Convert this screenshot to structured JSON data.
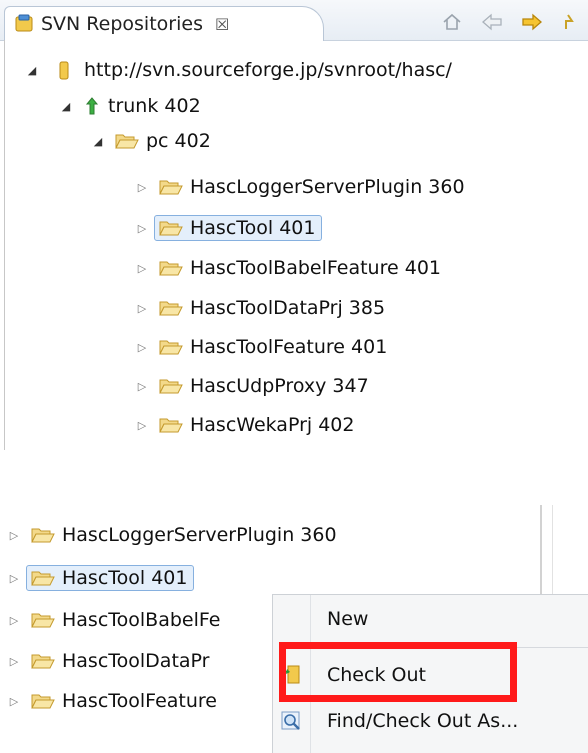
{
  "view": {
    "tab_title": "SVN Repositories",
    "tab_close_glyph": "☒",
    "toolbar_icons": [
      "home-icon",
      "back-arrow-icon",
      "forward-arrow-icon",
      "up-arrow-icon"
    ]
  },
  "tree": {
    "repo_url": "http://svn.sourceforge.jp/svnroot/hasc/",
    "trunk_label": "trunk 402",
    "pc_label": "pc 402",
    "projects": [
      "HascLoggerServerPlugin 360",
      "HascTool 401",
      "HascToolBabelFeature 401",
      "HascToolDataPrj 385",
      "HascToolFeature 401",
      "HascUdpProxy 347",
      "HascWekaPrj 402"
    ],
    "selected_index": 1
  },
  "zoom": {
    "projects": [
      "HascLoggerServerPlugin 360",
      "HascTool 401",
      "HascToolBabelFe",
      "HascToolDataPr",
      "HascToolFeature"
    ],
    "context_menu": {
      "items": [
        {
          "label": "New",
          "icon": ""
        },
        {
          "label": "Check Out",
          "icon": "checkout-icon"
        },
        {
          "label": "Find/Check Out As...",
          "icon": "find-checkout-icon"
        }
      ],
      "highlighted_item": "Check Out"
    }
  },
  "colors": {
    "highlight_border": "#ff1a1a",
    "folder_fill": "#f3d98a",
    "folder_stroke": "#c49a2d",
    "selection_bg": "#e4effb",
    "selection_border": "#86b0df",
    "trunk_arrow": "#2e9a3a"
  }
}
